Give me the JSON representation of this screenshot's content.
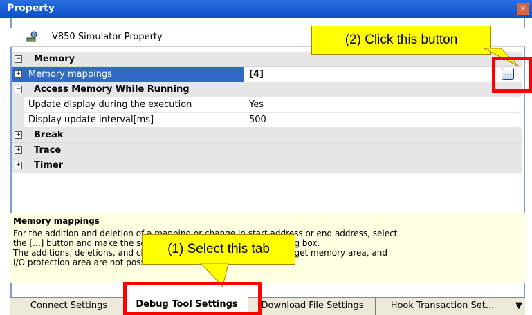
{
  "window": {
    "title": "Property",
    "close_icon": "close-icon"
  },
  "subheader": {
    "label": "V850 Simulator Property",
    "icon": "simulator-icon"
  },
  "grid": {
    "rows": [
      {
        "kind": "category",
        "label": "Memory",
        "expand_symbol": "⊟"
      },
      {
        "kind": "property",
        "label": "Memory mappings",
        "value": "[4]",
        "expand_symbol": "⊞"
      },
      {
        "kind": "category",
        "label": "Access Memory While Running",
        "expand_symbol": "⊟"
      },
      {
        "kind": "property",
        "label": "Update display during the execution",
        "value": "Yes"
      },
      {
        "kind": "property",
        "label": "Display update interval[ms]",
        "value": "500"
      },
      {
        "kind": "category",
        "label": "Break",
        "expand_symbol": "⊞"
      },
      {
        "kind": "category",
        "label": "Trace",
        "expand_symbol": "⊞"
      },
      {
        "kind": "category",
        "label": "Timer",
        "expand_symbol": "⊞"
      }
    ],
    "ellipsis_button_label": "..."
  },
  "description": {
    "title": "Memory mappings",
    "lines": [
      "For the addition and deletion of a mapping or change in start address or end address, select",
      "the [...] button and make the settings in the Memory mapping dialog box.",
      "The additions, deletions, and changes in internal ROM/RAM area target memory area, and",
      "I/O protection area are not possible."
    ]
  },
  "tabs": [
    {
      "label": "Connect Settings"
    },
    {
      "label": "Debug Tool Settings",
      "active": true
    },
    {
      "label": "Download File Settings"
    },
    {
      "label": "Hook Transaction Set..."
    }
  ],
  "tab_menu_icon": "chevron-down-icon",
  "callouts": {
    "click_button": "(2) Click this button",
    "select_tab": "(1) Select this tab"
  },
  "colors": {
    "title_bar": "#0b4fc9",
    "selection": "#316ac5",
    "callout": "#ffff00",
    "highlight": "#ff0000"
  }
}
